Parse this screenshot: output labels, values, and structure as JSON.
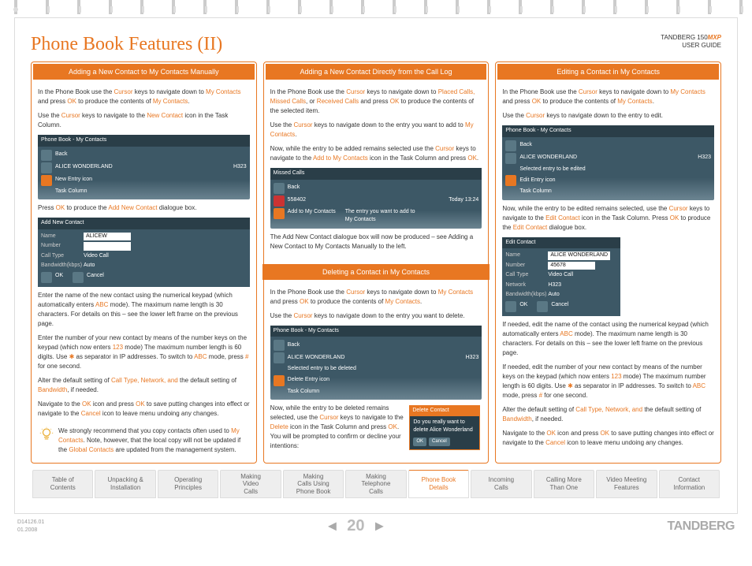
{
  "header": {
    "title": "Phone Book Features (II)",
    "product_line1": "TANDBERG 150",
    "product_mxp": "MXP",
    "product_line2": "USER GUIDE"
  },
  "col1": {
    "title": "Adding a New Contact to My Contacts Manually",
    "p1a": "In the Phone Book use the ",
    "p1b": "Cursor",
    "p1c": " keys to navigate down to ",
    "p1d": "My Contacts",
    "p1e": " and press ",
    "p1f": "OK",
    "p1g": " to produce the contents of ",
    "p1h": "My Contacts",
    "p1i": ".",
    "p2a": "Use the ",
    "p2b": "Cursor",
    "p2c": " keys to navigate to the ",
    "p2d": "New Contact",
    "p2e": " icon in the Task Column.",
    "shot1_title": "Phone Book - My Contacts",
    "shot1_back": "Back",
    "shot1_name": "ALICE WONDERLAND",
    "shot1_proto": "H323",
    "shot1_ann1": "New Entry icon",
    "shot1_ann2": "Task Column",
    "p3a": "Press ",
    "p3b": "OK",
    "p3c": " to produce the ",
    "p3d": "Add New Contact",
    "p3e": " dialogue box.",
    "form_title": "Add New Contact",
    "form_name_lbl": "Name",
    "form_name_val": "ALICEW",
    "form_num_lbl": "Number",
    "form_call_lbl": "Call Type",
    "form_call_val": "Video Call",
    "form_bw_lbl": "Bandwidth(kbps)",
    "form_bw_val": "Auto",
    "form_ok": "OK",
    "form_cancel": "Cancel",
    "p4a": "Enter the name of the new contact using the numerical keypad (which automatically enters ",
    "p4b": "ABC",
    "p4c": " mode). The maximum name length is 30 characters. For details on this – see the lower left frame on the previous page.",
    "p5a": "Enter the number of your new contact by means of the number keys on the keypad (which now enters ",
    "p5b": "123",
    "p5c": " mode)  The  maximum number length is 60 digits. Use ",
    "p5d": "✱",
    "p5e": " as separator in IP addresses. To switch to ",
    "p5f": "ABC",
    "p5g": " mode, press ",
    "p5h": "#",
    "p5i": " for one second.",
    "p6a": "Alter the default setting of ",
    "p6b": "Call Type, Network, and ",
    "p6c": "the default setting of ",
    "p6d": "Bandwidth",
    "p6e": ", if needed.",
    "p7a": "Navigate to the ",
    "p7b": "OK",
    "p7c": " icon and press ",
    "p7d": "OK",
    "p7e": " to save putting changes into effect or navigate to the ",
    "p7f": "Cancel",
    "p7g": " icon to leave menu undoing any changes.",
    "tip1": "We strongly recommend that you copy contacts often used to ",
    "tip2": "My Contacts",
    "tip3": ". Note, however, that the local copy will not be updated if the ",
    "tip4": "Global Contacts",
    "tip5": " are updated from the management system."
  },
  "col2": {
    "title": "Adding a New Contact Directly from the Call Log",
    "p1a": "In the Phone Book use the ",
    "p1b": "Cursor",
    "p1c": " keys to navigate down to ",
    "p1d": "Placed Calls, Missed Calls",
    "p1e": ", or ",
    "p1f": "Received Calls",
    "p1g": " and press ",
    "p1h": "OK",
    "p1i": " to produce the contents of the selected item.",
    "p2a": "Use the ",
    "p2b": "Cursor",
    "p2c": " keys to navigate down to the entry you want to add to ",
    "p2d": "My Contacts",
    "p2e": ".",
    "p3a": "Now, while the entry to be added remains selected use the ",
    "p3b": "Cursor",
    "p3c": " keys to navigate to the ",
    "p3d": "Add to My Contacts",
    "p3e": " icon in the Task Column and press ",
    "p3f": "OK",
    "p3g": ".",
    "shot1_title": "Missed Calls",
    "shot1_back": "Back",
    "shot1_num": "558402",
    "shot1_date": "Today 13:24",
    "shot1_ann1": "Add to My Contacts",
    "shot1_ann2": "The entry you want to add to My Contacts",
    "p4": "The Add New Contact dialogue box will now be produced – see Adding a New Contact to My Contacts Manually to the left.",
    "title2": "Deleting a Contact in My Contacts",
    "d1a": "In the Phone Book use the ",
    "d1b": "Cursor",
    "d1c": " keys to navigate down to ",
    "d1d": "My Contacts",
    "d1e": " and press ",
    "d1f": "OK",
    "d1g": " to produce the contents of ",
    "d1h": "My Contacts",
    "d1i": ".",
    "d2a": "Use the ",
    "d2b": "Cursor",
    "d2c": " keys to navigate down to the entry you want to delete.",
    "shot2_title": "Phone Book - My Contacts",
    "shot2_back": "Back",
    "shot2_name": "ALICE WONDERLAND",
    "shot2_proto": "H323",
    "shot2_ann1": "Selected entry to be deleted",
    "shot2_ann2": "Delete Entry icon",
    "shot2_ann3": "Task Column",
    "d3a": "Now, while the entry to be deleted remains selected, use the ",
    "d3b": "Cursor",
    "d3c": " keys to navigate to the ",
    "d3d": "Delete",
    "d3e": " icon in the Task Column and press ",
    "d3f": "OK",
    "d3g": ". You will be prompted to confirm or decline your intentions:",
    "prompt_title": "Delete Contact",
    "prompt_text": "Do you really want to delete Alice Wonderland",
    "prompt_ok": "OK",
    "prompt_cancel": "Cancel"
  },
  "col3": {
    "title": "Editing a Contact in My Contacts",
    "p1a": "In the Phone Book use the ",
    "p1b": "Cursor",
    "p1c": " keys to navigate down to ",
    "p1d": "My Contacts",
    "p1e": " and press ",
    "p1f": "OK",
    "p1g": " to produce the contents of ",
    "p1h": "My Contacts",
    "p1i": ".",
    "p2a": "Use the ",
    "p2b": "Cursor",
    "p2c": " keys to navigate down to the entry to edit.",
    "shot1_title": "Phone Book - My Contacts",
    "shot1_back": "Back",
    "shot1_name": "ALICE WONDERLAND",
    "shot1_proto": "H323",
    "shot1_ann1": "Selected entry to be edited",
    "shot1_ann2": "Edit Entry icon",
    "shot1_ann3": "Task Column",
    "p3a": "Now, while the entry to be edited remains selected, use the ",
    "p3b": "Cursor",
    "p3c": " keys to navigate to the ",
    "p3d": "Edit Contact",
    "p3e": " icon in the Task Column. Press ",
    "p3f": "OK",
    "p3g": " to produce the ",
    "p3h": "Edit Contact",
    "p3i": " dialogue box.",
    "form_title": "Edit Contact",
    "form_name_lbl": "Name",
    "form_name_val": "ALICE WONDERLAND",
    "form_num_lbl": "Number",
    "form_num_val": "45678",
    "form_call_lbl": "Call Type",
    "form_call_val": "Video Call",
    "form_net_lbl": "Network",
    "form_net_val": "H323",
    "form_bw_lbl": "Bandwidth(kbps)",
    "form_bw_val": "Auto",
    "form_ok": "OK",
    "form_cancel": "Cancel",
    "p4a": "If needed, edit the name of the contact using the numerical keypad (which automatically enters ",
    "p4b": "ABC",
    "p4c": " mode). The maximum name length is 30 characters. For details on this – see the lower left frame on the previous page.",
    "p5a": "If needed, edit the number of your new contact by means of the number keys on the keypad (which now enters ",
    "p5b": "123",
    "p5c": " mode)  The maximum number length is 60 digits. Use ",
    "p5d": "✱",
    "p5e": " as separator in IP addresses. To switch to ",
    "p5f": "ABC",
    "p5g": " mode, press ",
    "p5h": "#",
    "p5i": " for one second.",
    "p6a": "Alter the default setting of ",
    "p6b": "Call Type, Network, and ",
    "p6c": "the default setting of ",
    "p6d": "Bandwidth",
    "p6e": ", if needed.",
    "p7a": "Navigate to the ",
    "p7b": "OK",
    "p7c": " icon and press ",
    "p7d": "OK",
    "p7e": " to save putting changes into effect or navigate to the ",
    "p7f": "Cancel",
    "p7g": " icon to leave menu undoing any changes."
  },
  "nav": [
    "Table of\nContents",
    "Unpacking &\nInstallation",
    "Operating\nPrinciples",
    "Making\nVideo\nCalls",
    "Making\nCalls Using\nPhone Book",
    "Making\nTelephone\nCalls",
    "Phone Book\nDetails",
    "Incoming\nCalls",
    "Calling More\nThan One",
    "Video Meeting\nFeatures",
    "Contact\nInformation"
  ],
  "nav_active": 6,
  "footer": {
    "docid": "D14126.01",
    "date": "01.2008",
    "page": "20",
    "brand": "TANDBERG"
  }
}
